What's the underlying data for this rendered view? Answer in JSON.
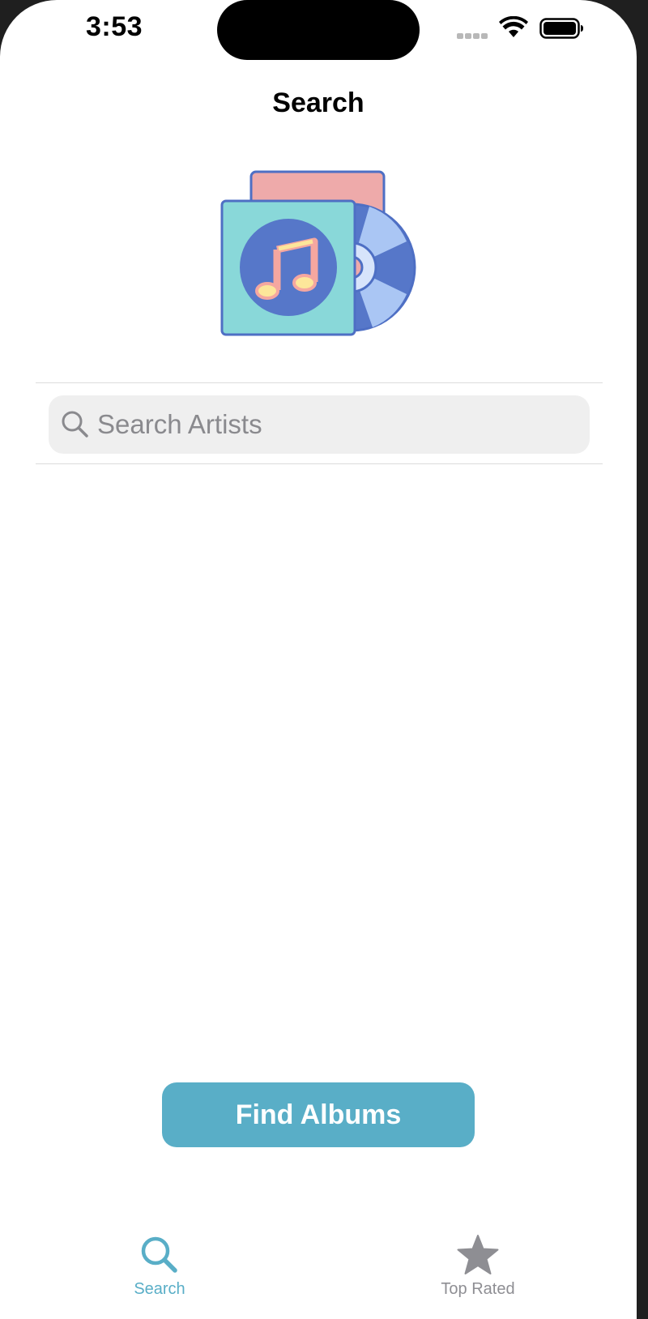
{
  "status_bar": {
    "time": "3:53"
  },
  "nav": {
    "title": "Search"
  },
  "hero": {
    "icon": "music-album-cd-icon"
  },
  "search": {
    "placeholder": "Search Artists",
    "value": ""
  },
  "action": {
    "find_albums_label": "Find Albums"
  },
  "tab_bar": {
    "items": [
      {
        "label": "Search",
        "icon": "search-icon",
        "selected": true
      },
      {
        "label": "Top Rated",
        "icon": "star-icon",
        "selected": false
      }
    ]
  },
  "colors": {
    "accent": "#59aec7",
    "inactive": "#8e8e93",
    "search_field_bg": "#efefef"
  }
}
